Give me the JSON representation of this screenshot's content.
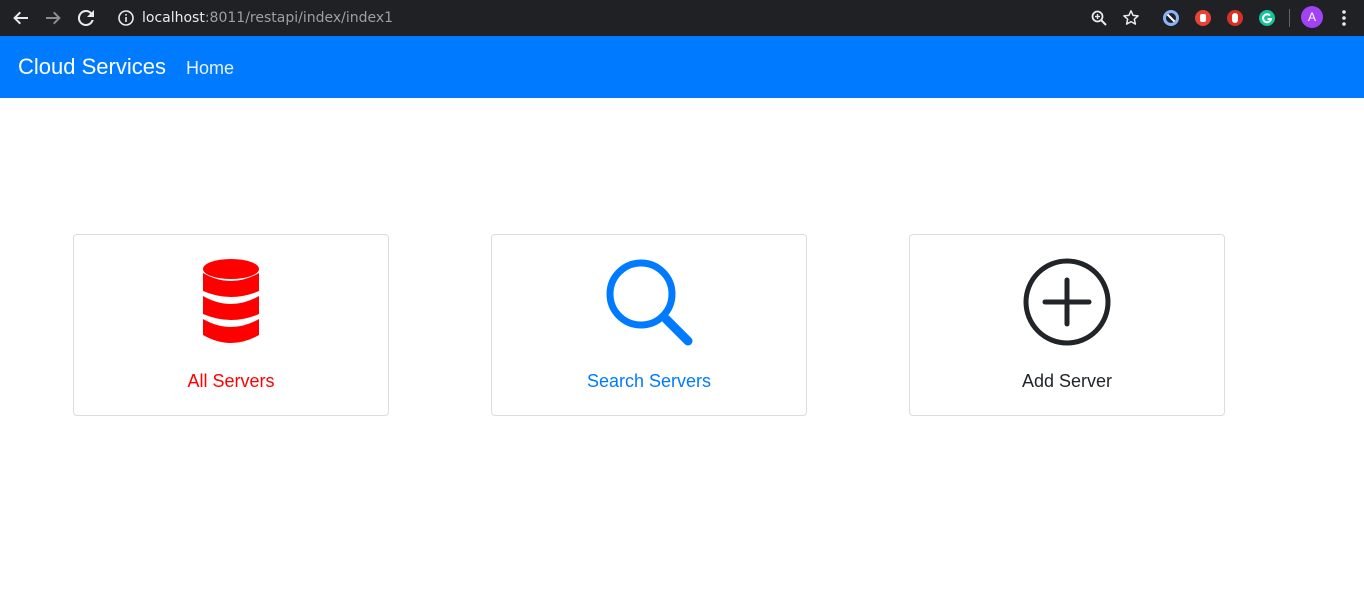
{
  "browser": {
    "url_host": "localhost",
    "url_path": ":8011/restapi/index/index1",
    "avatar_letter": "A",
    "icons": [
      "back-icon",
      "forward-icon",
      "reload-icon",
      "info-icon",
      "zoom-icon",
      "star-icon",
      "extension-icon",
      "extension-icon",
      "extension-icon",
      "grammarly-icon",
      "menu-icon"
    ]
  },
  "navbar": {
    "brand": "Cloud Services",
    "home": "Home",
    "color": "#007bff"
  },
  "cards": [
    {
      "label": "All Servers",
      "icon": "database-icon",
      "color": "#ff0000"
    },
    {
      "label": "Search Servers",
      "icon": "search-icon",
      "color": "#007bff"
    },
    {
      "label": "Add Server",
      "icon": "plus-circle-icon",
      "color": "#212529"
    }
  ]
}
